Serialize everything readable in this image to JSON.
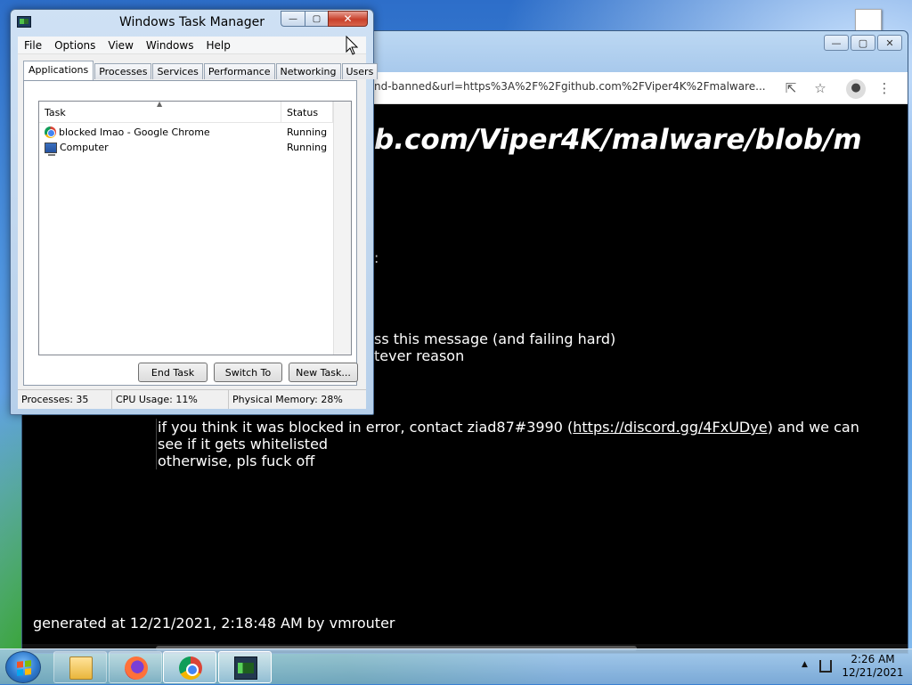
{
  "chrome": {
    "url_text": "nd-banned&url=https%3A%2F%2Fgithub.com%2FViper4K%2Fmalware...",
    "big_url": "b.com/Viper4K/malware/blob/m",
    "colon": ":",
    "line1": "ss this message (and failing hard)",
    "line2": "tever reason",
    "msg_part1": "if you think it was blocked in error, contact ziad87#3990 (",
    "msg_link": "https://discord.gg/4FxUDye",
    "msg_part2": ") and we can see if it gets whitelisted",
    "msg_line3": "otherwise, pls fuck off",
    "generated": "generated at 12/21/2021, 2:18:48 AM by vmrouter",
    "icons": [
      "share-icon",
      "star-icon",
      "profile-icon",
      "kebab-menu-icon"
    ]
  },
  "taskmgr": {
    "title": "Windows Task Manager",
    "menu": [
      "File",
      "Options",
      "View",
      "Windows",
      "Help"
    ],
    "tabs": [
      "Applications",
      "Processes",
      "Services",
      "Performance",
      "Networking",
      "Users"
    ],
    "active_tab": "Applications",
    "columns": {
      "task": "Task",
      "status": "Status"
    },
    "rows": [
      {
        "task": "blocked lmao - Google Chrome",
        "status": "Running",
        "icon": "chrome-icon"
      },
      {
        "task": "Computer",
        "status": "Running",
        "icon": "computer-icon"
      }
    ],
    "buttons": {
      "end_task": "End Task",
      "switch_to": "Switch To",
      "new_task": "New Task..."
    },
    "statusbar": {
      "processes": "Processes: 35",
      "cpu": "CPU Usage: 11%",
      "memory": "Physical Memory: 28%"
    },
    "window_controls": {
      "minimize": "—",
      "maximize": "▢",
      "close": "✕"
    }
  },
  "taskbar": {
    "apps": [
      "windows-explorer-icon",
      "firefox-icon",
      "chrome-icon",
      "task-manager-icon"
    ],
    "time": "2:26 AM",
    "date": "12/21/2021"
  }
}
